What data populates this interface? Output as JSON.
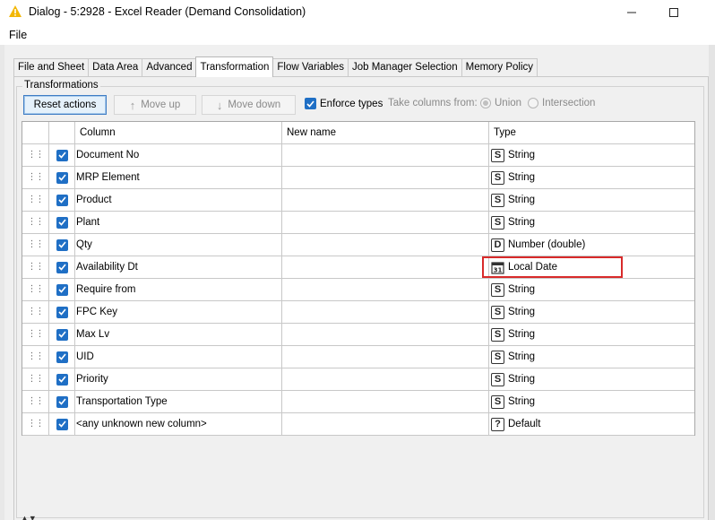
{
  "window": {
    "title": "Dialog - 5:2928 - Excel Reader (Demand Consolidation)",
    "warning_color": "#f2b705"
  },
  "menu": {
    "file": "File"
  },
  "tabs": [
    {
      "label": "File and Sheet",
      "active": false
    },
    {
      "label": "Data Area",
      "active": false
    },
    {
      "label": "Advanced",
      "active": false
    },
    {
      "label": "Transformation",
      "active": true
    },
    {
      "label": "Flow Variables",
      "active": false
    },
    {
      "label": "Job Manager Selection",
      "active": false
    },
    {
      "label": "Memory Policy",
      "active": false
    }
  ],
  "transformations": {
    "group_label": "Transformations",
    "reset_label": "Reset actions",
    "move_up_label": "Move up",
    "move_down_label": "Move down",
    "enforce_types_label": "Enforce types",
    "enforce_types_checked": true,
    "take_columns_label": "Take columns from:",
    "union_label": "Union",
    "intersection_label": "Intersection",
    "union_selected": true
  },
  "table": {
    "headers": {
      "column": "Column",
      "new_name": "New name",
      "type": "Type"
    },
    "rows": [
      {
        "column": "Document No",
        "new_name": "",
        "type_icon": "S",
        "type": "String",
        "checked": true
      },
      {
        "column": "MRP Element",
        "new_name": "",
        "type_icon": "S",
        "type": "String",
        "checked": true
      },
      {
        "column": "Product",
        "new_name": "",
        "type_icon": "S",
        "type": "String",
        "checked": true
      },
      {
        "column": "Plant",
        "new_name": "",
        "type_icon": "S",
        "type": "String",
        "checked": true
      },
      {
        "column": "Qty",
        "new_name": "",
        "type_icon": "D",
        "type": "Number (double)",
        "checked": true
      },
      {
        "column": "Availability Dt",
        "new_name": "",
        "type_icon": "calendar",
        "type": "Local Date",
        "checked": true
      },
      {
        "column": "Require from",
        "new_name": "",
        "type_icon": "S",
        "type": "String",
        "checked": true
      },
      {
        "column": "FPC Key",
        "new_name": "",
        "type_icon": "S",
        "type": "String",
        "checked": true
      },
      {
        "column": "Max Lv",
        "new_name": "",
        "type_icon": "S",
        "type": "String",
        "checked": true
      },
      {
        "column": "UID",
        "new_name": "",
        "type_icon": "S",
        "type": "String",
        "checked": true
      },
      {
        "column": "Priority",
        "new_name": "",
        "type_icon": "S",
        "type": "String",
        "checked": true
      },
      {
        "column": "Transportation Type",
        "new_name": "",
        "type_icon": "S",
        "type": "String",
        "checked": true
      },
      {
        "column": "<any unknown new column>",
        "new_name": "",
        "type_icon": "?",
        "type": "Default",
        "checked": true
      }
    ],
    "highlight_color": "#d82a2a"
  }
}
